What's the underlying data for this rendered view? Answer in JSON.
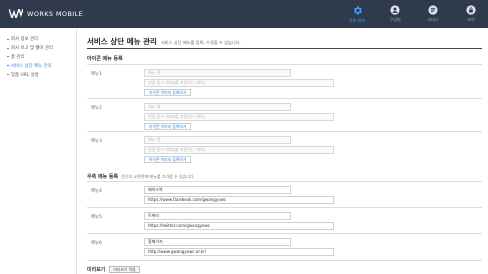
{
  "header": {
    "logo_text": "WORKS MOBILE",
    "nav": [
      {
        "label": "기본 관리",
        "icon": "gear-icon",
        "active": true
      },
      {
        "label": "구성원",
        "icon": "members-icon",
        "active": false
      },
      {
        "label": "서비스",
        "icon": "service-icon",
        "active": false
      },
      {
        "label": "보안",
        "icon": "lock-icon",
        "active": false
      }
    ],
    "colors": {
      "bar": "#2f3b4c",
      "active": "#3aa0ff"
    }
  },
  "sidebar": {
    "items": [
      {
        "label": "회사 정보 관리",
        "active": false
      },
      {
        "label": "회사 로고 및 웹아 관리",
        "active": false
      },
      {
        "label": "홈 관리",
        "active": false
      },
      {
        "label": "서비스 상단 메뉴 관리",
        "active": true
      },
      {
        "label": "맞춤 URL 설정",
        "active": false
      }
    ]
  },
  "main": {
    "title": "서비스 상단 메뉴 관리",
    "description": "서비스 상단 메뉴를 등록, 수정할 수 있습니다.",
    "icon_section": {
      "heading": "아이콘 메뉴 등록",
      "menus": [
        {
          "label": "메뉴1",
          "name_placeholder": "메뉴 명",
          "url_placeholder": "연결 링크 (http를 포함하는 URL)",
          "button": "아이콘 이미지 등록하기"
        },
        {
          "label": "메뉴2",
          "name_placeholder": "메뉴 명",
          "url_placeholder": "연결 링크 (http를 포함하는 URL)",
          "button": "아이콘 이미지 등록하기"
        },
        {
          "label": "메뉴3",
          "name_placeholder": "메뉴 명",
          "url_placeholder": "연결 링크 (http를 포함하는 URL)",
          "button": "아이콘 이미지 등록하기"
        }
      ]
    },
    "text_section": {
      "heading": "우측 메뉴 등록",
      "subheading": "상단의 오른쪽에 메뉴를 추가할 수 있습니다.",
      "menus": [
        {
          "label": "메뉴4",
          "name": "페이스북",
          "url": "https://www.facebook.com/gwangyowc"
        },
        {
          "label": "메뉴5",
          "name": "트위터",
          "url": "https://twitter.com/gwangyowc"
        },
        {
          "label": "메뉴6",
          "name": "홈페이지",
          "url": "http://www.gwangyowc.or.kr/"
        }
      ]
    },
    "preview": {
      "label": "미리보기",
      "button": "미리보기 적용"
    }
  }
}
